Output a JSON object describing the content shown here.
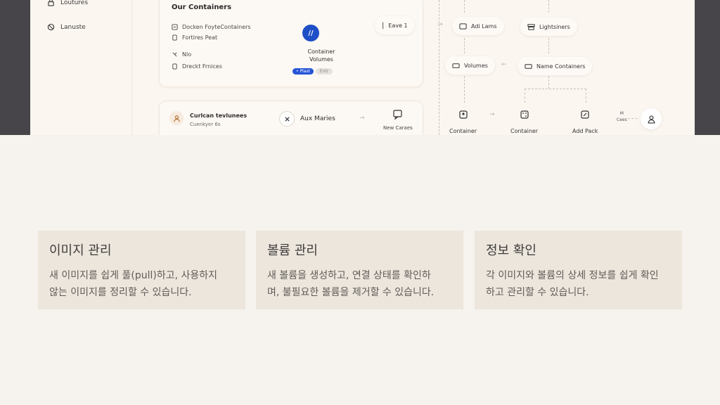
{
  "screenshot": {
    "sidebar": {
      "items": [
        {
          "label": "Loutures",
          "icon": "lock-icon"
        },
        {
          "label": "Lanuste",
          "icon": "no-entry-icon"
        }
      ]
    },
    "containers_card": {
      "title": "Our Containers",
      "rows": [
        {
          "label": "Docken FoyteContainers",
          "icon": "box-icon"
        },
        {
          "label": "Fortires Peat",
          "icon": "file-icon"
        },
        {
          "label": "Nlo",
          "icon": "link-icon"
        },
        {
          "label": "Dreckt Frnices",
          "icon": "square-icon"
        }
      ],
      "volumes_badge": "//",
      "volumes_label": "Container Volumes",
      "pill_primary": "• Plast",
      "pill_secondary": "Entr"
    },
    "bottom_card": {
      "title": "Curlcan tevlunees",
      "subtitle": "Cuenkyer 6s",
      "action_label": "Aux Maries",
      "new_label": "New Caraes"
    },
    "flow": {
      "eave": "Eave 1",
      "adi_lams": "Adi Lams",
      "lightsiners": "Lightsiners",
      "volumes": "Volumes",
      "name_containers": "Name Containers",
      "container_a": "Container",
      "container_b": "Container",
      "add_pack": "Add Pack",
      "m_label": "M",
      "cees_label": "Cees"
    }
  },
  "features": [
    {
      "title": "이미지 관리",
      "line1": "새 이미지를 쉽게 풀(pull)하고, 사용하지",
      "line2": "않는 이미지를 정리할 수 있습니다."
    },
    {
      "title": "볼륨 관리",
      "line1": "새 볼륨을 생성하고, 연결 상태를 확인하",
      "line2": "며, 불필요한 볼륨을 제거할 수 있습니다."
    },
    {
      "title": "정보 확인",
      "line1": "각 이미지와 볼륨의 상세 정보를 쉽게 확인",
      "line2": "하고 관리할 수 있습니다."
    }
  ]
}
